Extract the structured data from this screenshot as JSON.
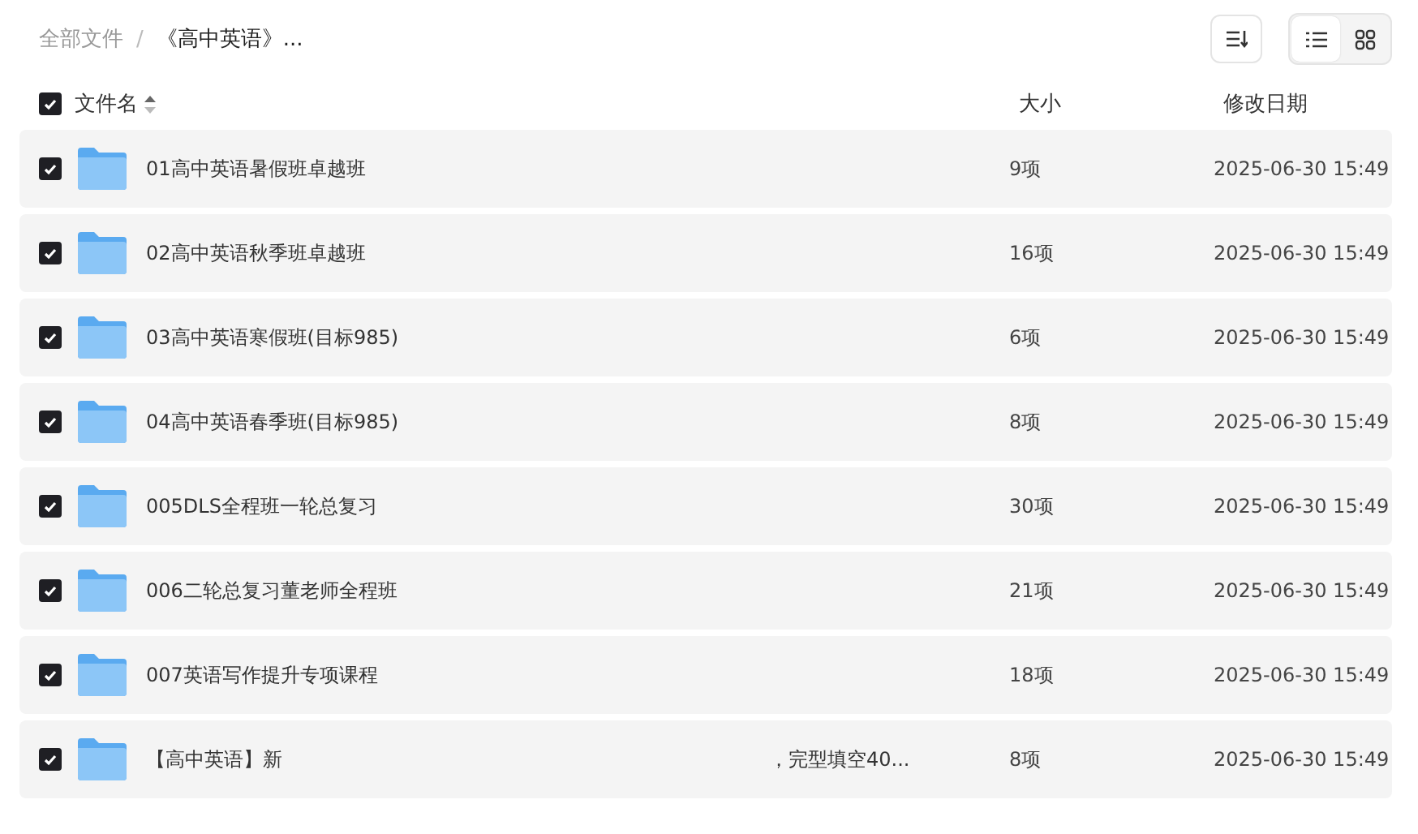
{
  "breadcrumb_separator": "/",
  "breadcrumb": [
    {
      "label": "全部文件",
      "current": false
    },
    {
      "label": "《高中英语》...",
      "current": true
    }
  ],
  "toolbar": {
    "view_modes": [
      {
        "kind": "list",
        "selected": true
      },
      {
        "kind": "grid",
        "selected": false
      }
    ]
  },
  "header": {
    "checked": true,
    "columns": [
      "文件名",
      "大小",
      "修改日期"
    ]
  },
  "rows": [
    {
      "checked": true,
      "name": "01高中英语暑假班卓越班",
      "size": "9项",
      "date": "2025-06-30 15:49"
    },
    {
      "checked": true,
      "name": "02高中英语秋季班卓越班",
      "size": "16项",
      "date": "2025-06-30 15:49"
    },
    {
      "checked": true,
      "name": "03高中英语寒假班(目标985)",
      "size": "6项",
      "date": "2025-06-30 15:49"
    },
    {
      "checked": true,
      "name": "04高中英语春季班(目标985)",
      "size": "8项",
      "date": "2025-06-30 15:49"
    },
    {
      "checked": true,
      "name": "005DLS全程班一轮总复习",
      "size": "30项",
      "date": "2025-06-30 15:49"
    },
    {
      "checked": true,
      "name": "006二轮总复习董老师全程班",
      "size": "21项",
      "date": "2025-06-30 15:49"
    },
    {
      "checked": true,
      "name": "007英语写作提升专项课程",
      "size": "18项",
      "date": "2025-06-30 15:49"
    },
    {
      "checked": true,
      "name": "【高中英语】新",
      "name_end": "，完型填空40...",
      "size": "8项",
      "date": "2025-06-30 15:49"
    }
  ]
}
